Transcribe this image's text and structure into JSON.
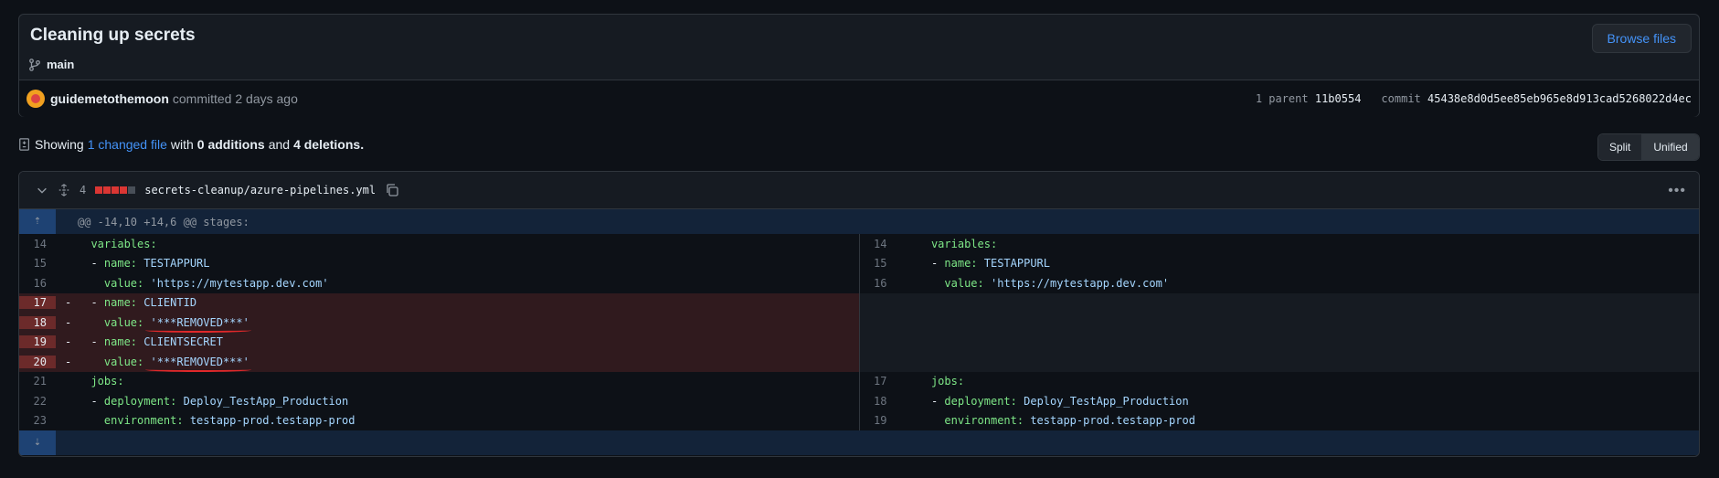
{
  "commit": {
    "title": "Cleaning up secrets",
    "branch": "main",
    "browse_label": "Browse files",
    "author": "guidemetothemoon",
    "committed_text": "committed 2 days ago",
    "parent_label": "1 parent",
    "parent_sha": "11b0554",
    "commit_label": "commit",
    "commit_sha": "45438e8d0d5ee85eb965e8d913cad5268022d4ec"
  },
  "summary": {
    "showing": "Showing",
    "changed": "1 changed file",
    "with": "with",
    "additions": "0 additions",
    "and": "and",
    "deletions": "4 deletions."
  },
  "view": {
    "split": "Split",
    "unified": "Unified"
  },
  "file": {
    "count": "4",
    "path": "secrets-cleanup/azure-pipelines.yml",
    "hunk": "@@ -14,10 +14,6 @@ stages:",
    "left": [
      {
        "ln": "14",
        "sign": "",
        "key": "variables:",
        "val": "",
        "indent": "  ",
        "type": "ctx"
      },
      {
        "ln": "15",
        "sign": "",
        "key": "- name:",
        "val": " TESTAPPURL",
        "indent": "  ",
        "type": "ctx"
      },
      {
        "ln": "16",
        "sign": "",
        "key": "value:",
        "val": " 'https://mytestapp.dev.com'",
        "indent": "    ",
        "type": "ctx"
      },
      {
        "ln": "17",
        "sign": "-",
        "key": "- name:",
        "val": " CLIENTID",
        "indent": "  ",
        "type": "del"
      },
      {
        "ln": "18",
        "sign": "-",
        "key": "value:",
        "val": " '***REMOVED***'",
        "indent": "    ",
        "type": "del"
      },
      {
        "ln": "19",
        "sign": "-",
        "key": "- name:",
        "val": " CLIENTSECRET",
        "indent": "  ",
        "type": "del"
      },
      {
        "ln": "20",
        "sign": "-",
        "key": "value:",
        "val": " '***REMOVED***'",
        "indent": "    ",
        "type": "del"
      },
      {
        "ln": "21",
        "sign": "",
        "key": "jobs:",
        "val": "",
        "indent": "  ",
        "type": "ctx"
      },
      {
        "ln": "22",
        "sign": "",
        "key": "- deployment:",
        "val": " Deploy_TestApp_Production",
        "indent": "  ",
        "type": "ctx"
      },
      {
        "ln": "23",
        "sign": "",
        "key": "environment:",
        "val": " testapp-prod.testapp-prod",
        "indent": "    ",
        "type": "ctx"
      }
    ],
    "right": [
      {
        "ln": "14",
        "key": "variables:",
        "val": "",
        "indent": "  "
      },
      {
        "ln": "15",
        "key": "- name:",
        "val": " TESTAPPURL",
        "indent": "  "
      },
      {
        "ln": "16",
        "key": "value:",
        "val": " 'https://mytestapp.dev.com'",
        "indent": "    "
      },
      {
        "ln": "",
        "key": "",
        "val": "",
        "indent": "",
        "type": "empty"
      },
      {
        "ln": "",
        "key": "",
        "val": "",
        "indent": "",
        "type": "empty"
      },
      {
        "ln": "",
        "key": "",
        "val": "",
        "indent": "",
        "type": "empty"
      },
      {
        "ln": "",
        "key": "",
        "val": "",
        "indent": "",
        "type": "empty"
      },
      {
        "ln": "17",
        "key": "jobs:",
        "val": "",
        "indent": "  "
      },
      {
        "ln": "18",
        "key": "- deployment:",
        "val": " Deploy_TestApp_Production",
        "indent": "  "
      },
      {
        "ln": "19",
        "key": "environment:",
        "val": " testapp-prod.testapp-prod",
        "indent": "    "
      }
    ]
  },
  "icons": {
    "branch": "git-branch-icon",
    "diff": "file-diff-icon",
    "chevron": "chevron-down-icon",
    "expand": "unfold-icon",
    "copy": "copy-icon",
    "kebab": "kebab-horizontal-icon",
    "expand_up": "expand-up-icon",
    "expand_down": "expand-down-icon"
  },
  "colors": {
    "deletion": "#da3633",
    "link": "#4493f8",
    "annotation": "#e0282a"
  }
}
